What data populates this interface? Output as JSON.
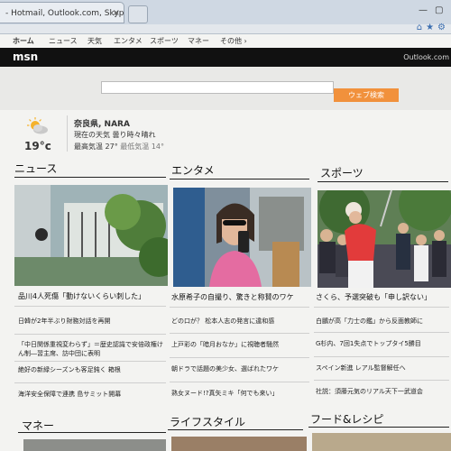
{
  "browser": {
    "tab_title": "- Hotmail, Outlook.com, Skype, ...",
    "tab_close": "×",
    "window_min": "—",
    "window_max": "▢"
  },
  "nav": {
    "items": [
      "ホーム",
      "ニュース",
      "天気",
      "エンタメ",
      "スポーツ",
      "マネー",
      "その他 ›"
    ]
  },
  "header": {
    "logo": "msn",
    "outlook_link": "Outlook.com"
  },
  "search": {
    "placeholder": "",
    "button_label": "ウェブ検索"
  },
  "weather": {
    "icon": "partly-cloudy-icon",
    "temperature": "19°c",
    "location": "奈良県, NARA",
    "condition": "現在の天気  曇り時々晴れ",
    "high": "最高気温 27°",
    "low": "最低気温 14°"
  },
  "sections": {
    "news": {
      "title": "ニュース",
      "caption": "品川4人死傷「動けないくらい刺した」",
      "links": [
        "日韓が2年半ぶり財務対話を再開",
        "「中日関係重視変わらず」＝歴史認識で安倍政権けん制―習主席、訪中団に表明",
        "絶好の新緑シーズンも客足鈍く 箱根",
        "海洋安全保障で連携 島サミット開幕"
      ]
    },
    "entertainment": {
      "title": "エンタメ",
      "caption": "水原希子の自撮り、驚きと称賛のワケ",
      "links": [
        "どの口が？ 松本人志の発言に違和感",
        "上戸彩の「暗月おなか」に視聴者騒然",
        "朝ドラで話題の美少女、選ばれたワケ",
        "熟女ヌード!?真矢ミキ「何でも来い」"
      ]
    },
    "sports": {
      "title": "スポーツ",
      "caption": "さくら、予選突破も「申し訳ない」",
      "links": [
        "白鵬が高「力士の鑑」から反面教師に",
        "G杉内、7回1失点でトップタイ5勝目",
        "スペイン新進 レアル監督解任へ",
        "社説：須藤元気のリアル天下一武道会"
      ]
    },
    "money": {
      "title": "マネー"
    },
    "lifestyle": {
      "title": "ライフスタイル"
    },
    "food": {
      "title": "フード&レシピ"
    }
  },
  "colors": {
    "header_bg": "#111111",
    "search_button": "#f1913c",
    "page_bg": "#f3f3f1"
  }
}
